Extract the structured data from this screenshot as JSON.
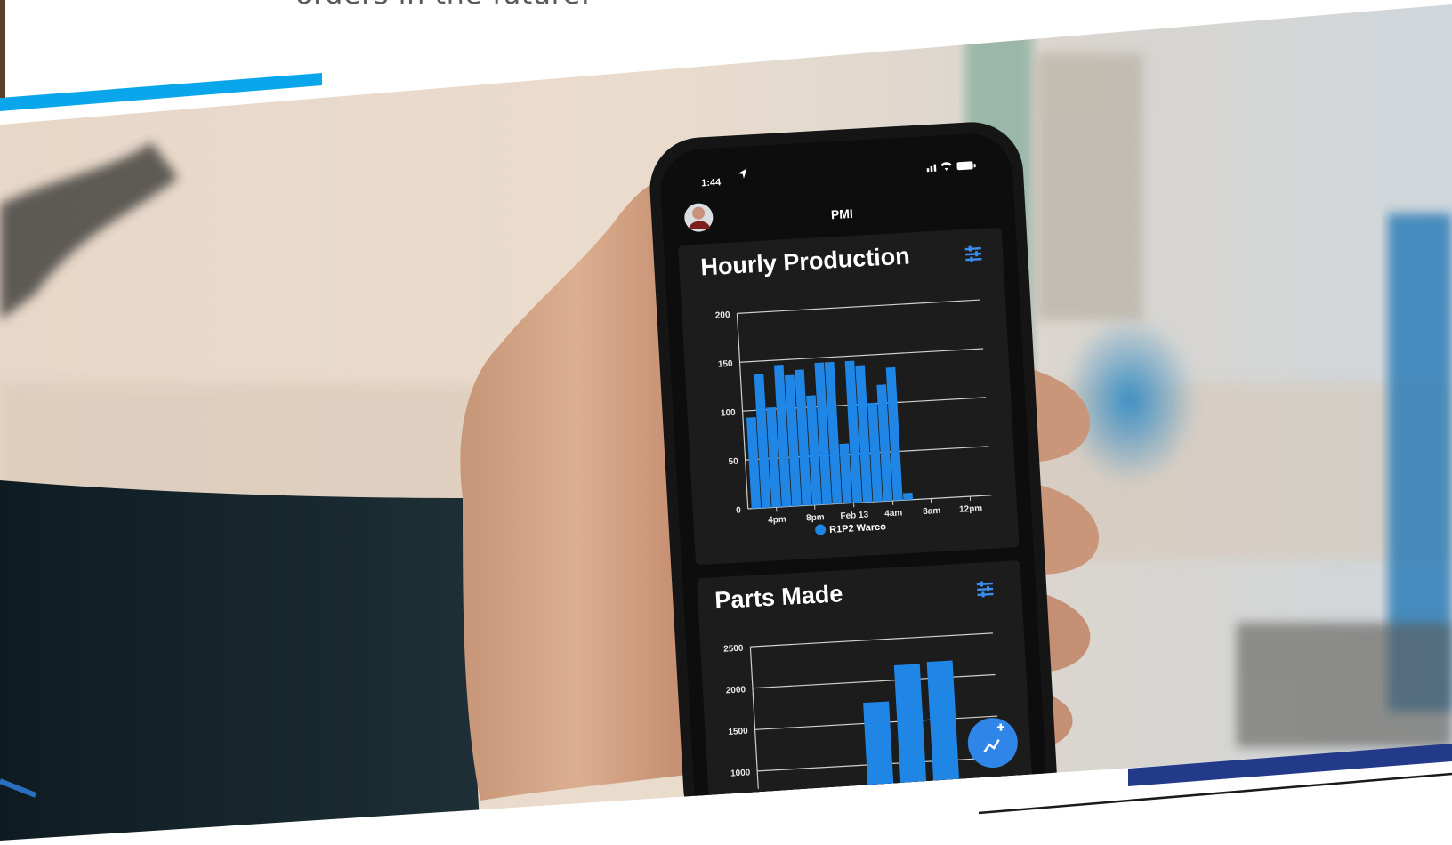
{
  "caption": "orders in the future.",
  "phone": {
    "time": "1:44",
    "app_title": "PMI",
    "card1": {
      "title": "Hourly Production"
    },
    "card2": {
      "title": "Parts Made"
    },
    "colors": {
      "bar": "#1f86e6",
      "card": "#1c1c1d",
      "screen": "#0d0d0e",
      "accent": "#3a8ef0"
    },
    "icons": [
      "location-arrow-icon",
      "signal-icon",
      "wifi-icon",
      "battery-icon",
      "filter-icon",
      "add-chart-icon"
    ]
  },
  "chart_data": [
    {
      "type": "bar",
      "title": "Hourly Production",
      "y_ticks": [
        "200",
        "150",
        "100",
        "50",
        "0"
      ],
      "ylim": [
        0,
        200
      ],
      "x_ticks": [
        "4pm",
        "8pm",
        "Feb 13",
        "4am",
        "8am",
        "12pm"
      ],
      "legend": "R1P2 Warco",
      "values": [
        93,
        137,
        102,
        145,
        134,
        139,
        112,
        145,
        145,
        61,
        145,
        140,
        101,
        119,
        136,
        7
      ]
    },
    {
      "type": "bar",
      "title": "Parts Made",
      "y_ticks": [
        "2500",
        "2000",
        "1500",
        "1000"
      ],
      "ylim": [
        1000,
        2500
      ],
      "values": [
        1750,
        2180,
        2200
      ]
    }
  ]
}
